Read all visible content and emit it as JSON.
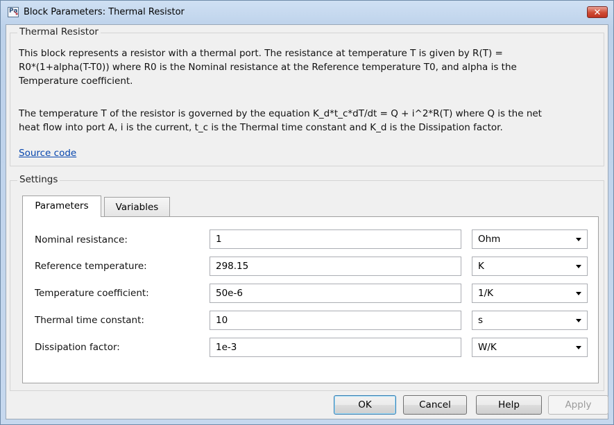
{
  "window": {
    "title": "Block Parameters: Thermal Resistor",
    "icon_text": "Pa",
    "icon_arrow": "↘",
    "close_symbol": "✕"
  },
  "description": {
    "group_title": "Thermal Resistor",
    "para1_line1": "This block represents a resistor with a thermal port. The resistance at temperature T is given by R(T) =",
    "para1_line2": "R0*(1+alpha(T-T0)) where R0 is the Nominal resistance at the Reference temperature T0, and alpha is the",
    "para1_line3": "Temperature coefficient.",
    "para2_line1": "The temperature T of the resistor is governed by the equation K_d*t_c*dT/dt = Q + i^2*R(T) where Q is the net",
    "para2_line2": "heat flow into port A, i is the current, t_c is the Thermal time constant and K_d is the Dissipation factor.",
    "source_link": "Source code"
  },
  "settings": {
    "group_title": "Settings",
    "tabs": [
      {
        "label": "Parameters",
        "active": true
      },
      {
        "label": "Variables",
        "active": false
      }
    ],
    "params": [
      {
        "label": "Nominal resistance:",
        "value": "1",
        "unit": "Ohm"
      },
      {
        "label": "Reference temperature:",
        "value": "298.15",
        "unit": "K"
      },
      {
        "label": "Temperature coefficient:",
        "value": "50e-6",
        "unit": "1/K"
      },
      {
        "label": "Thermal time constant:",
        "value": "10",
        "unit": "s"
      },
      {
        "label": "Dissipation factor:",
        "value": "1e-3",
        "unit": "W/K"
      }
    ]
  },
  "buttons": {
    "ok": "OK",
    "cancel": "Cancel",
    "help": "Help",
    "apply": "Apply"
  },
  "colors": {
    "link": "#0645ad",
    "close_button": "#cf4b34",
    "title_bar": "#c6d8ee"
  }
}
